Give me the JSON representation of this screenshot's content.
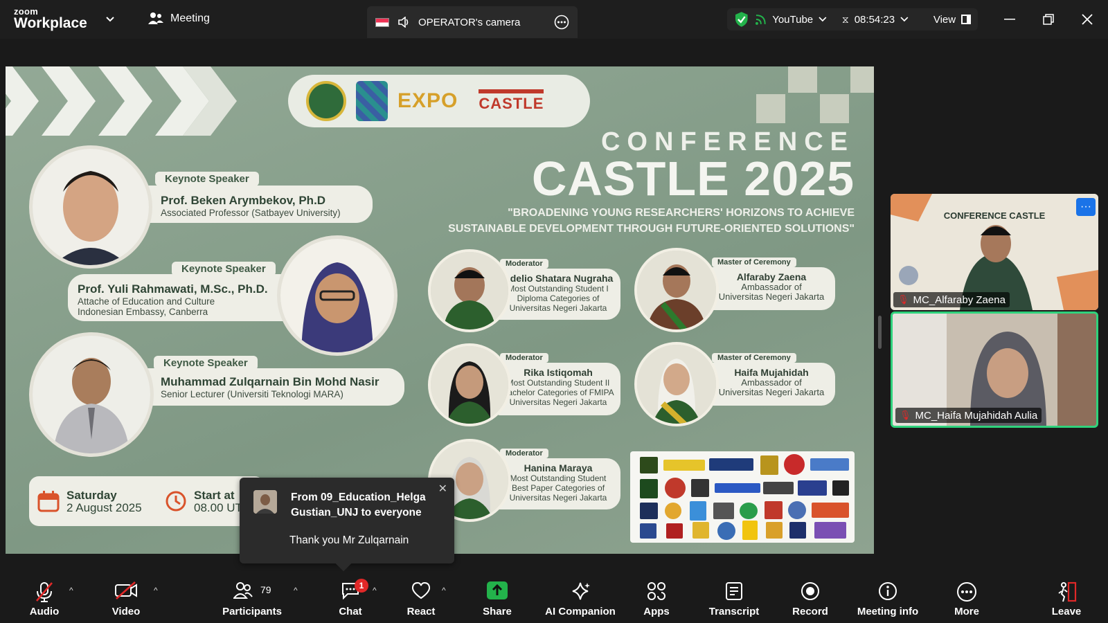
{
  "app": {
    "brand_top": "zoom",
    "brand_bottom": "Workplace"
  },
  "topbar": {
    "meeting_label": "Meeting",
    "camera_label": "OPERATOR's camera",
    "stream_label": "YouTube",
    "timer": "08:54:23",
    "view_label": "View"
  },
  "poster": {
    "conference_label": "CONFERENCE",
    "title": "CASTLE 2025",
    "theme_line1": "\"BROADENING YOUNG RESEARCHERS' HORIZONS TO ACHIEVE",
    "theme_line2": "SUSTAINABLE DEVELOPMENT THROUGH FUTURE-ORIENTED SOLUTIONS\"",
    "logo_expo": "EXPO",
    "logo_castle": "CASTLE",
    "keynotes": [
      {
        "role": "Keynote Speaker",
        "name": "Prof. Beken Arymbekov, Ph.D",
        "aff1": "Associated Professor (Satbayev University)",
        "aff2": ""
      },
      {
        "role": "Keynote Speaker",
        "name": "Prof. Yuli Rahmawati, M.Sc., Ph.D.",
        "aff1": "Attache of Education and Culture",
        "aff2": "Indonesian Embassy, Canberra"
      },
      {
        "role": "Keynote Speaker",
        "name": "Muhammad Zulqarnain Bin Mohd Nasir",
        "aff1": "Senior Lecturer (Universiti Teknologi MARA)",
        "aff2": ""
      }
    ],
    "moderators": [
      {
        "role": "Moderator",
        "name": "Adelio Shatara Nugraha",
        "d1": "Most Outstanding Student I",
        "d2": "Diploma Categories of",
        "d3": "Universitas Negeri Jakarta"
      },
      {
        "role": "Moderator",
        "name": "Rika Istiqomah",
        "d1": "Most Outstanding Student II",
        "d2": "Bachelor Categories of FMIPA",
        "d3": "Universitas Negeri Jakarta"
      },
      {
        "role": "Moderator",
        "name": "Hanina Maraya",
        "d1": "Most Outstanding Student",
        "d2": "Best Paper Categories of",
        "d3": "Universitas Negeri Jakarta"
      }
    ],
    "mcs": [
      {
        "role": "Master of Ceremony",
        "name": "Alfaraby Zaena",
        "d1": "Ambassador of",
        "d2": "Universitas Negeri Jakarta"
      },
      {
        "role": "Master of Ceremony",
        "name": "Haifa Mujahidah",
        "d1": "Ambassador of",
        "d2": "Universitas Negeri Jakarta"
      }
    ],
    "date_day": "Saturday",
    "date_full": "2 August 2025",
    "start_label": "Start at",
    "start_time": "08.00 UT"
  },
  "participants_panel": {
    "tile1_name": "MC_Alfaraby Zaena",
    "tile1_banner": "CONFERENCE CASTLE",
    "tile2_name": "MC_Haifa Mujahidah Aulia"
  },
  "toast": {
    "from": "From 09_Education_Helga Gustian_UNJ to everyone",
    "message": "Thank you Mr Zulqarnain"
  },
  "toolbar": {
    "audio": "Audio",
    "video": "Video",
    "participants": "Participants",
    "participants_count": "79",
    "chat": "Chat",
    "chat_badge": "1",
    "react": "React",
    "share": "Share",
    "ai": "AI Companion",
    "apps": "Apps",
    "transcript": "Transcript",
    "record": "Record",
    "meeting_info": "Meeting info",
    "more": "More",
    "leave": "Leave"
  },
  "colors": {
    "accent_green": "#2fd27c",
    "leave_red": "#e02828",
    "poster_green": "#8aa08e"
  }
}
